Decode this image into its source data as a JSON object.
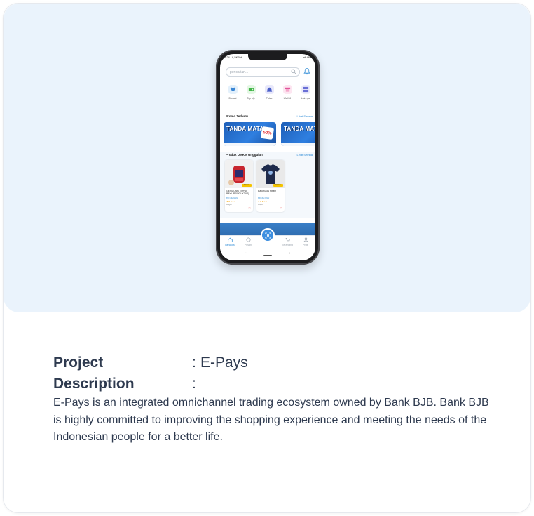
{
  "phone": {
    "status": {
      "time": "5.24 | 8,5KB/d",
      "right": "all 46"
    },
    "search_placeholder": "pencarian...",
    "categories": [
      {
        "label": "Donasi",
        "icon": "donation-icon",
        "color": "#e3f0fb",
        "fg": "#3a86d4"
      },
      {
        "label": "Top Up",
        "icon": "topup-icon",
        "color": "#e4f7e4",
        "fg": "#43b649"
      },
      {
        "label": "Pulsa",
        "icon": "pulse-phone-icon",
        "color": "#e8e8fb",
        "fg": "#4a5fc8"
      },
      {
        "label": "UMKM",
        "icon": "store-icon",
        "color": "#fde6f1",
        "fg": "#e0559a"
      },
      {
        "label": "Lainnya",
        "icon": "grid-icon",
        "color": "#ececfb",
        "fg": "#6a6fd6"
      }
    ],
    "promo": {
      "title": "Promo Terbaru",
      "see_all": "Lihat Semua",
      "banner_text": "TANDA MATA",
      "banner_badge": "50%"
    },
    "products": {
      "title": "Produk UMKM Unggulan",
      "see_all": "Lihat Semua",
      "items": [
        {
          "name": "GENDONG TUPAI BAYI (PRODUKTIVI)...",
          "price": "Rp 80.000",
          "stars": "★★★☆☆",
          "location": "Bogor",
          "tag": "Diskon"
        },
        {
          "name": "Baju Kaos Hitam",
          "price": "Rp 80.000",
          "stars": "★★★☆☆",
          "location": "Bogor",
          "tag": "Diskon"
        }
      ]
    },
    "nav": [
      {
        "label": "Beranda",
        "icon": "home-icon",
        "active": true
      },
      {
        "label": "Pesan",
        "icon": "chat-icon",
        "active": false
      },
      {
        "label": "Keranjang",
        "icon": "cart-icon",
        "active": false
      },
      {
        "label": "Profil",
        "icon": "profile-icon",
        "active": false
      }
    ]
  },
  "info": {
    "project_label": "Project",
    "project_colon": ":",
    "project_value": "E-Pays",
    "description_label": "Description",
    "description_colon": ":",
    "description_text": "E-Pays is an integrated omnichannel trading ecosystem owned by Bank BJB. Bank BJB is highly committed to improving the shopping experience and meeting the needs of the Indonesian people for a better life."
  },
  "colors": {
    "hero_background": "#eaf3fc",
    "text": "#2e3a4f",
    "accent": "#2e8bd6"
  }
}
